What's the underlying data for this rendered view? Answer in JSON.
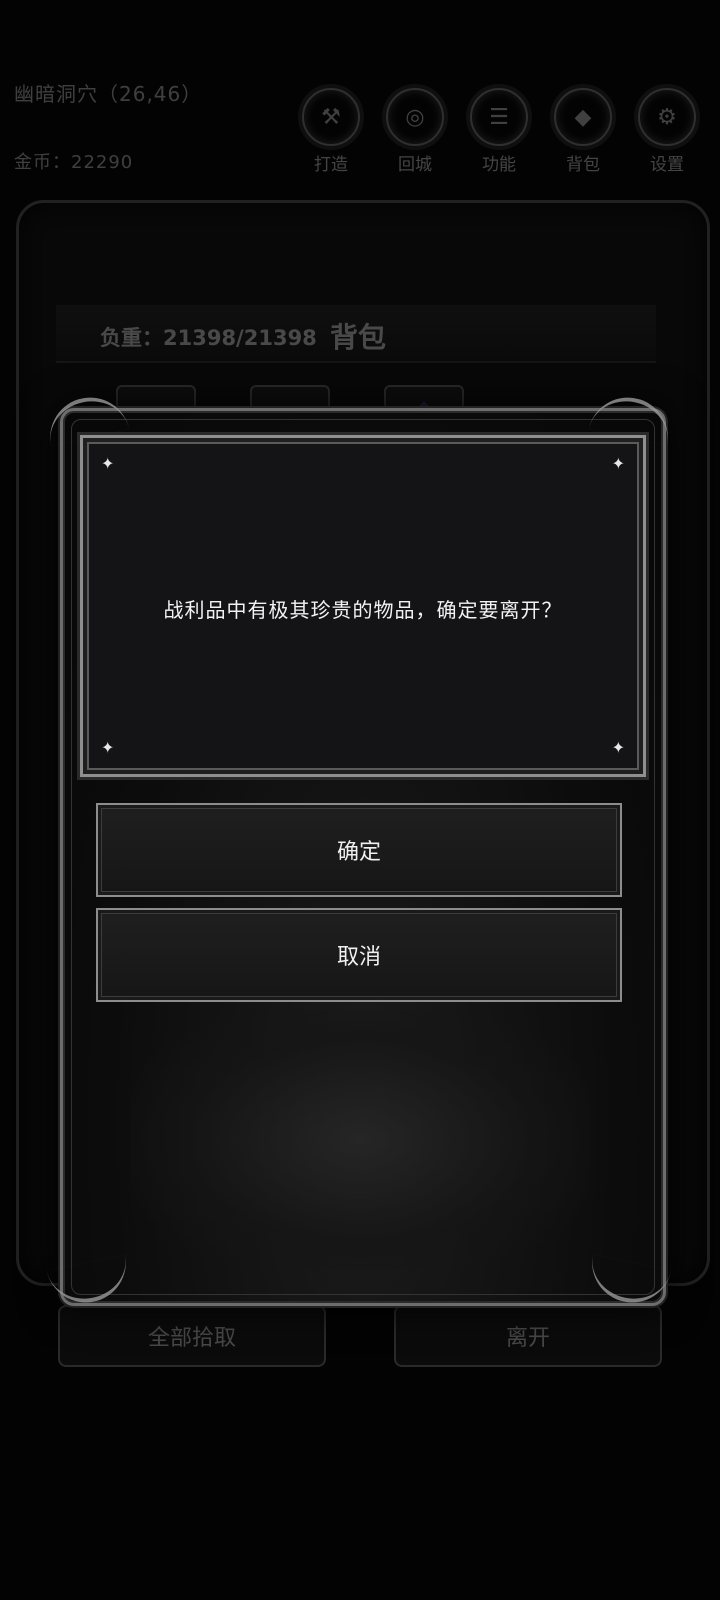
{
  "background": {
    "location": "幽暗洞穴（26,46）",
    "gold": "金币：22290",
    "top_buttons": [
      {
        "label": "打造",
        "icon": "hammer-icon",
        "glyph": "⚒"
      },
      {
        "label": "回城",
        "icon": "portal-icon",
        "glyph": "◎"
      },
      {
        "label": "功能",
        "icon": "menu-icon",
        "glyph": "☰"
      },
      {
        "label": "背包",
        "icon": "bag-icon",
        "glyph": "◆"
      },
      {
        "label": "设置",
        "icon": "gear-icon",
        "glyph": "⚙"
      }
    ],
    "bag": {
      "weight": "负重：21398/21398",
      "title": "背包"
    },
    "pick_all_label": "全部拾取",
    "leave_label": "离开"
  },
  "dialog": {
    "message": "战利品中有极其珍贵的物品，确定要离开？",
    "confirm_label": "确定",
    "cancel_label": "取消",
    "sparkle": "✦"
  },
  "colors": {
    "frame": "#8f8f8f",
    "text": "#f2f2f2",
    "panel": "#141416"
  }
}
